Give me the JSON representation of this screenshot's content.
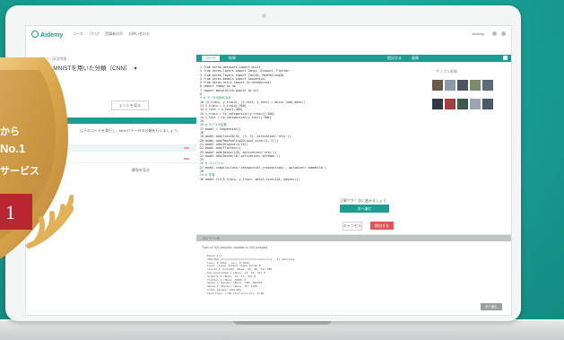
{
  "colors": {
    "accent": "#1a9e93",
    "danger": "#e05555",
    "badge_gold": "#d9a54a",
    "badge_red": "#b9262f"
  },
  "header": {
    "logo": "Aidemy",
    "nav": [
      "コース",
      "ブログ",
      "受講者の声",
      "お問い合わせ"
    ],
    "user": "Aidemy"
  },
  "left": {
    "breadcrumb": "タスク / 演習問題",
    "task_title": "3.2.2 MNISTを用いた分類（CNN）",
    "button": "ヒントを見る",
    "instruction": "以下のコードを実行し、MNISTデータの分類を行いましょう。",
    "item": "解答を見る"
  },
  "code": {
    "tabs": [
      "コード",
      "結果"
    ],
    "tab_right": "提出する",
    "dialog_label": "正解です！次に進みましょう",
    "dialog_button": "次へ進む",
    "cancel": "キャンセル",
    "run": "提出する",
    "lines": [
      "1  from keras.datasets import mnist",
      "2  from keras.layers import Dense, Dropout, Flatten",
      "3  from keras.layers import Conv2D, MaxPooling2D",
      "4  from keras.models import Sequential",
      "5  from keras.utils import to_categorical",
      "6  import numpy as np",
      "7  import matplotlib.pyplot as plt",
      "8  ",
      "9  # データの読み込み",
      "10 (X_train, y_train), (X_test, y_test) = mnist.load_data()",
      "11 X_train = X_train[:300]",
      "12 X_test = X_test[:300]",
      "13 y_train = to_categorical(y_train)[:300]",
      "14 y_test = to_categorical(y_test)[:300]",
      "15 ",
      "16 # モデルの定義",
      "17 model = Sequential()",
      "18 ",
      "19 model.add(Conv2D(32, (3, 3), activation='relu'))",
      "20 model.add(MaxPooling2D(pool_size=(2, 2)))",
      "21 model.add(Dropout(0.25))",
      "22 model.add(Flatten())",
      "23 model.add(Dense(128, activation='relu'))",
      "24 model.add(Dense(10, activation='softmax'))",
      "25 ",
      "26 # コンパイル",
      "27 model.compile(loss='categorical_crossentropy', optimizer='adadelta')",
      "28 ",
      "29 # 学習",
      "30 model.fit(X_train, y_train, batch_size=128, epochs=1)"
    ]
  },
  "images": {
    "title": "画像",
    "caption": "サンプル画像"
  },
  "output": {
    "label": "コンソール",
    "summary": "Train on 300 samples, validate on 300 samples",
    "lines": [
      "Epoch 1/1",
      "300/300 [==============================] - 1s 3ms/step",
      "loss: 2.2451 - acc: 0.1833",
      "Layer (type)        Output Shape       Param #",
      "conv2d_1 (Conv2D)   (None, 26, 26, 32) 320",
      "max_pooling2d_1     (None, 13, 13, 32) 0",
      "dropout_1           (None, 13, 13, 32) 0",
      "flatten_1           (None, 5408)       0",
      "dense_1 (Dense)     (None, 128)        692352",
      "dense_2 (Dense)     (None, 10)         1290",
      "Total params: 693,962",
      "Test loss: 1.96  Test accuracy: 0.48"
    ],
    "button": "次へ進む"
  },
  "badge": {
    "line1": "から",
    "line2": "No.1",
    "line3": "サービス",
    "number": "1"
  }
}
